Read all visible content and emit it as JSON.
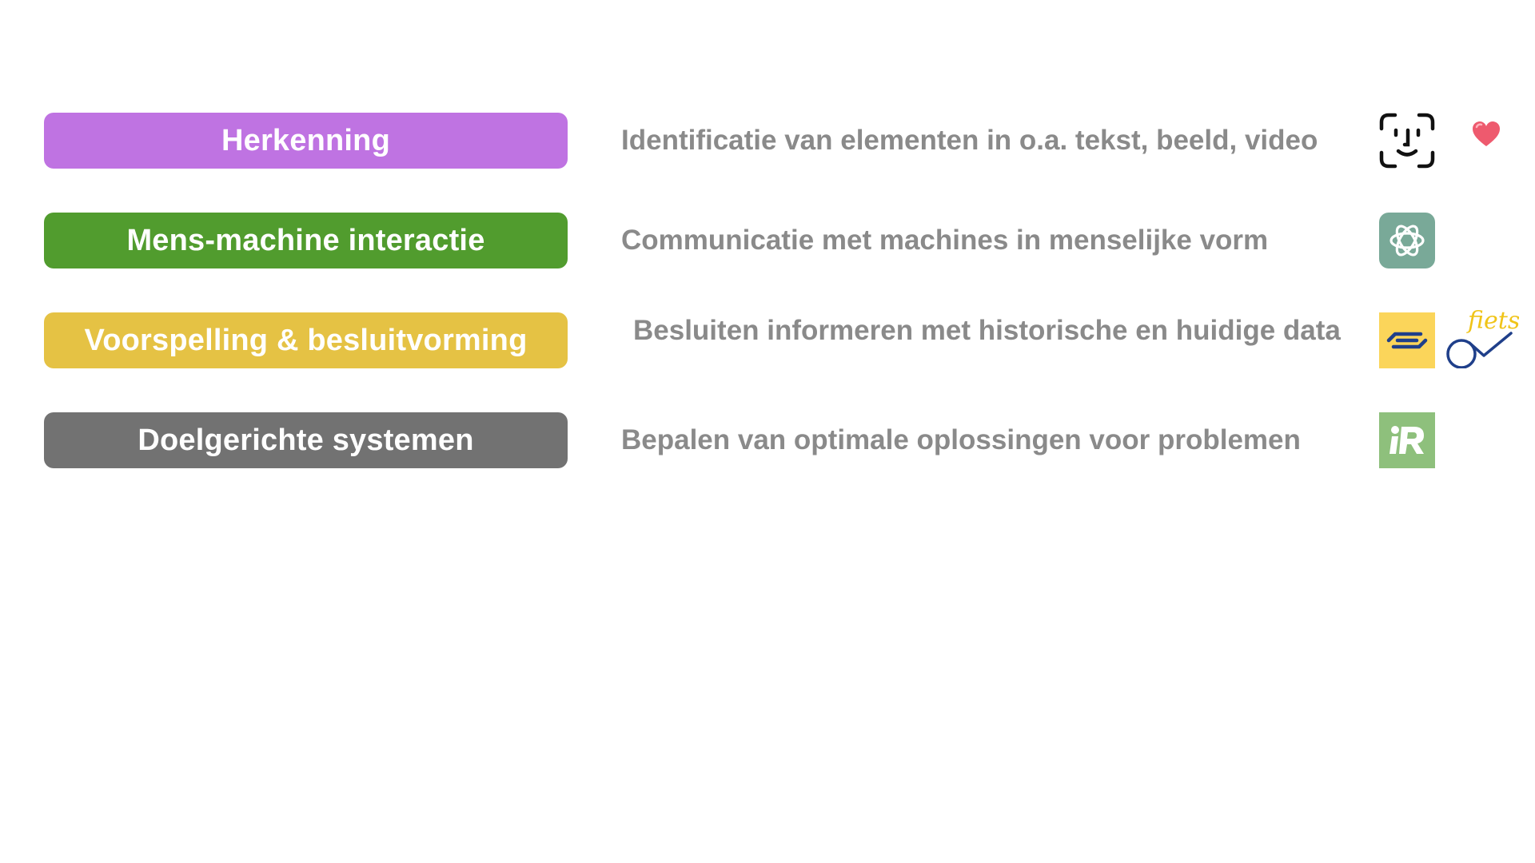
{
  "rows": [
    {
      "label": "Herkenning",
      "description": "Identificatie van elementen in o.a. tekst, beeld, video",
      "color": "#bf73e2",
      "icons": [
        "face-id-icon",
        "heart-icon"
      ]
    },
    {
      "label": "Mens-machine interactie",
      "description": "Communicatie met machines in menselijke vorm",
      "color": "#519c2e",
      "icons": [
        "chatgpt-logo-icon"
      ]
    },
    {
      "label": "Voorspelling & besluitvorming",
      "description": "Besluiten informeren met historische en huidige data",
      "color": "#e5c244",
      "icons": [
        "ns-logo-icon",
        "ov-fiets-logo-icon"
      ]
    },
    {
      "label": "Doelgerichte systemen",
      "description": "Bepalen van optimale oplossingen voor problemen",
      "color": "#727272",
      "icons": [
        "iris-logo-icon"
      ]
    }
  ],
  "logos": {
    "ov_fiets_text": "fiets"
  }
}
